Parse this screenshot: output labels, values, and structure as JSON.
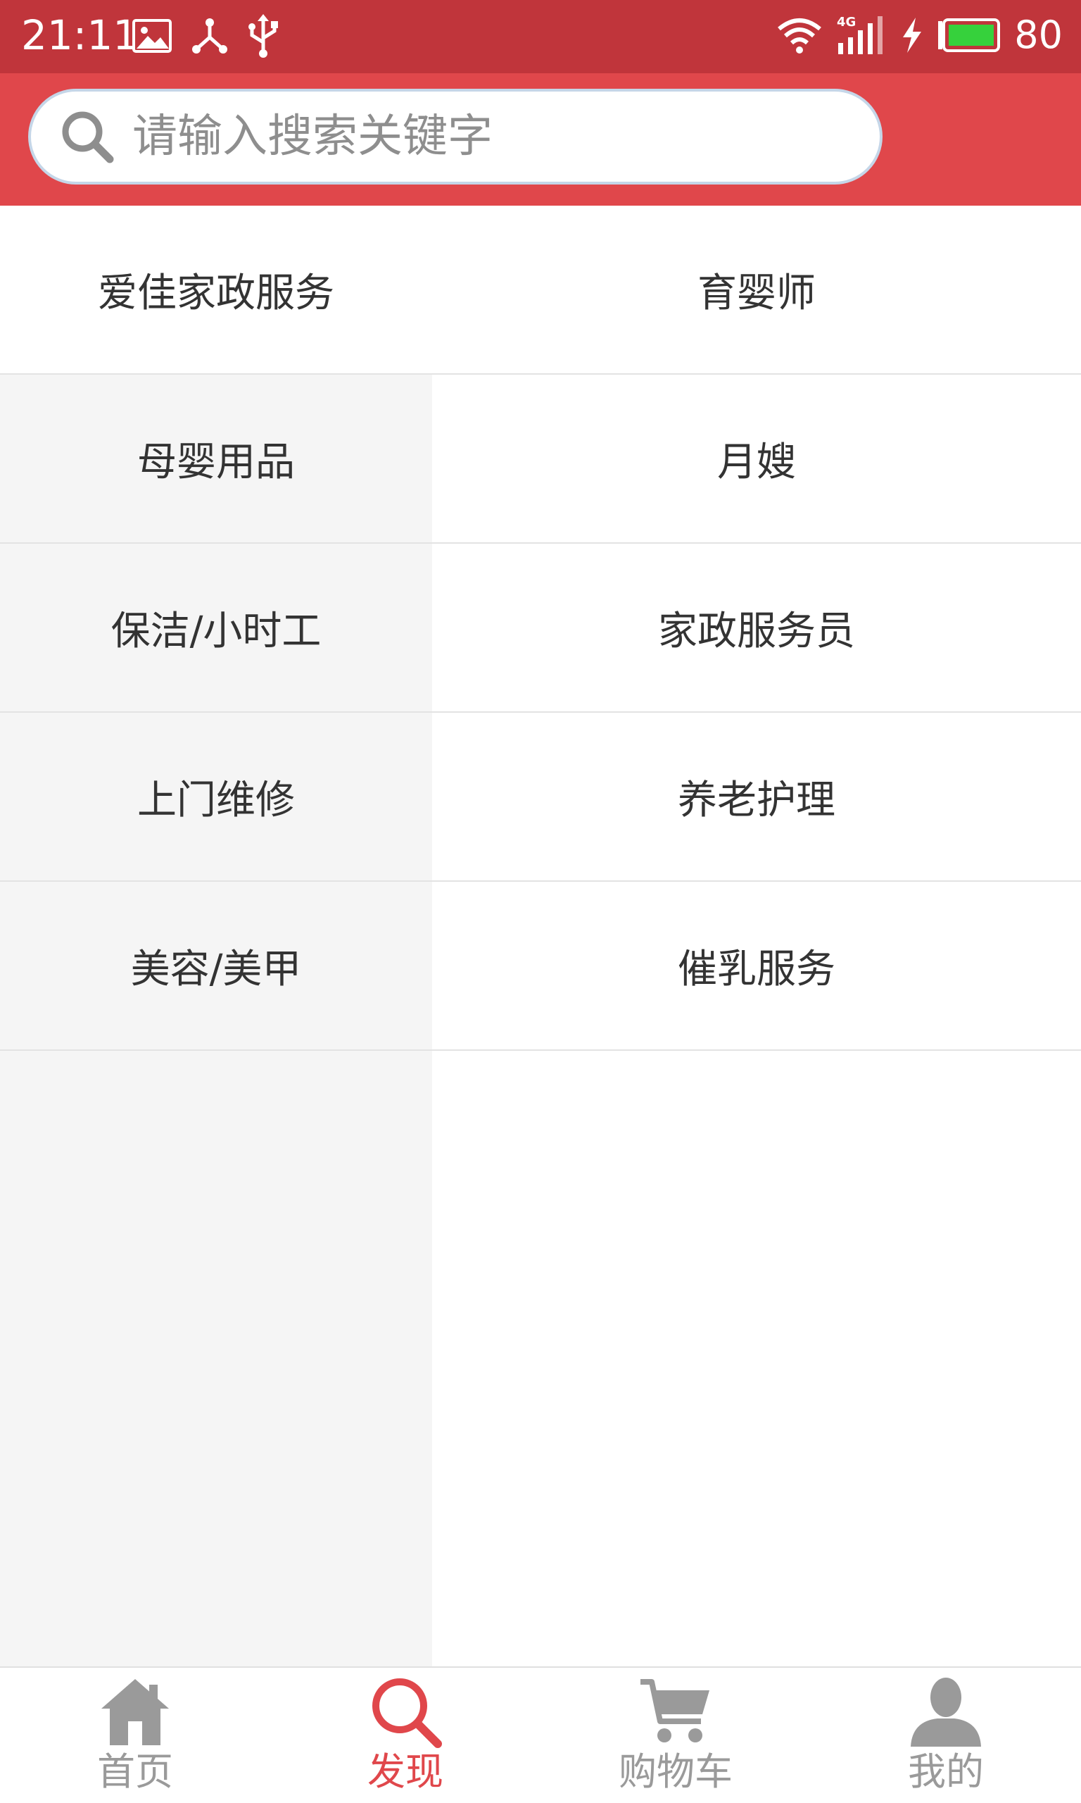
{
  "status_bar": {
    "time": "21:11",
    "network": "4G",
    "battery": "80",
    "icons": [
      "image-icon",
      "share-icon",
      "usb-icon",
      "wifi-icon",
      "signal-icon",
      "charging-icon",
      "battery-icon"
    ]
  },
  "search": {
    "placeholder": "请输入搜索关键字",
    "icon": "search-icon"
  },
  "categories": {
    "rows": [
      {
        "left": "爱佳家政服务",
        "right": "育婴师"
      },
      {
        "left": "母婴用品",
        "right": "月嫂"
      },
      {
        "left": "保洁/小时工",
        "right": "家政服务员"
      },
      {
        "left": "上门维修",
        "right": "养老护理"
      },
      {
        "left": "美容/美甲",
        "right": "催乳服务"
      }
    ]
  },
  "tabs": [
    {
      "label": "首页",
      "icon": "home-icon",
      "active": false
    },
    {
      "label": "发现",
      "icon": "search-icon",
      "active": true
    },
    {
      "label": "购物车",
      "icon": "cart-icon",
      "active": false
    },
    {
      "label": "我的",
      "icon": "user-icon",
      "active": false
    }
  ],
  "colors": {
    "status_bar": "#c0353b",
    "header": "#e0474b",
    "active_tab": "#e0474b",
    "inactive_tab": "#9a9a9a",
    "left_column_bg": "#f5f5f5"
  }
}
